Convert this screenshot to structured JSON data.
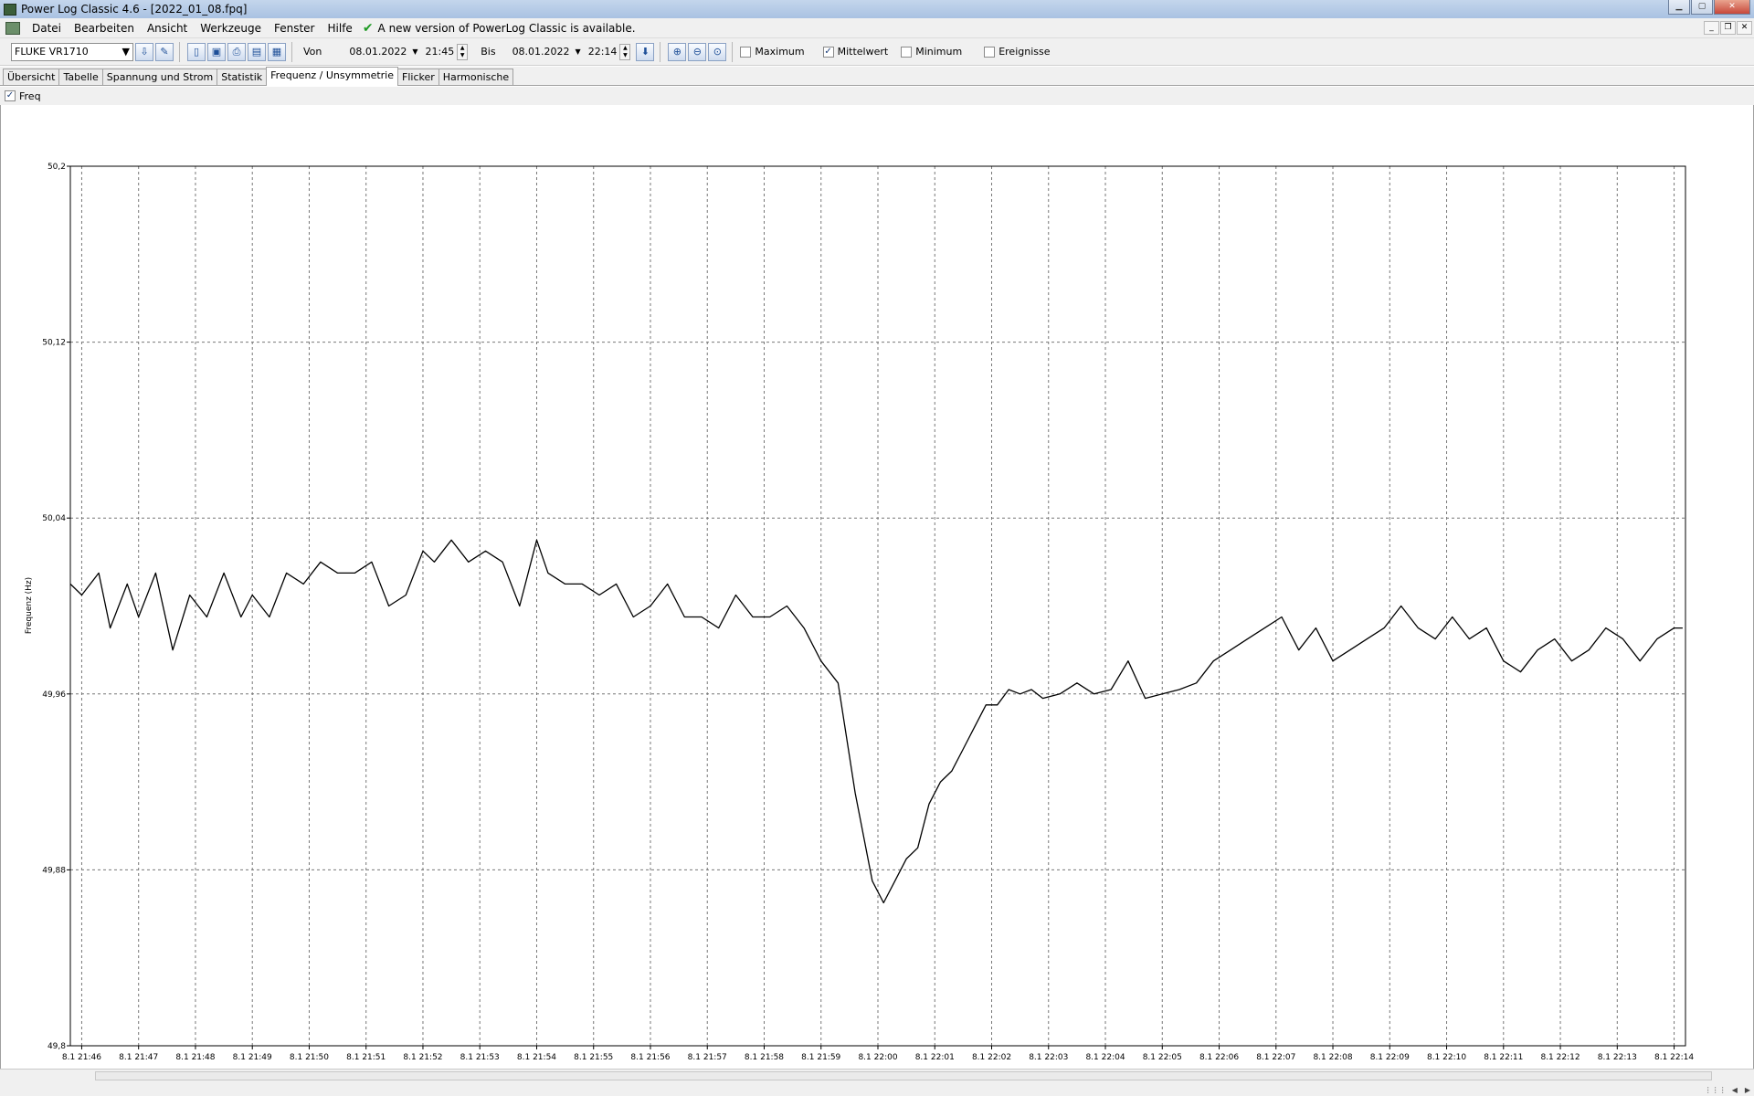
{
  "window": {
    "title": "Power Log Classic 4.6 - [2022_01_08.fpq]"
  },
  "menu": {
    "items": [
      "Datei",
      "Bearbeiten",
      "Ansicht",
      "Werkzeuge",
      "Fenster",
      "Hilfe"
    ],
    "update_notice": "A new version of PowerLog Classic is available."
  },
  "toolbar": {
    "device": "FLUKE VR1710",
    "from_label": "Von",
    "from_date": "08.01.2022",
    "from_time": "21:45",
    "to_label": "Bis",
    "to_date": "08.01.2022",
    "to_time": "22:14",
    "checkboxes": [
      {
        "label": "Maximum",
        "checked": false
      },
      {
        "label": "Mittelwert",
        "checked": true
      },
      {
        "label": "Minimum",
        "checked": false
      },
      {
        "label": "Ereignisse",
        "checked": false
      }
    ]
  },
  "tabs": [
    {
      "label": "Übersicht",
      "active": false
    },
    {
      "label": "Tabelle",
      "active": false
    },
    {
      "label": "Spannung und Strom",
      "active": false
    },
    {
      "label": "Statistik",
      "active": false
    },
    {
      "label": "Frequenz / Unsymmetrie",
      "active": true
    },
    {
      "label": "Flicker",
      "active": false
    },
    {
      "label": "Harmonische",
      "active": false
    }
  ],
  "series_toggle": {
    "label": "Freq",
    "checked": true
  },
  "chart_data": {
    "type": "line",
    "title": "",
    "xlabel": "",
    "ylabel": "Frequenz (Hz)",
    "ylim": [
      49.8,
      50.2
    ],
    "xlim_minutes": [
      45.8,
      74.2
    ],
    "yticks": [
      "50,2",
      "50,12",
      "50,04",
      "49,96",
      "49,88",
      "49,8"
    ],
    "ytick_values": [
      50.2,
      50.12,
      50.04,
      49.96,
      49.88,
      49.8
    ],
    "xtick_labels": [
      "8.1 21:46",
      "8.1 21:47",
      "8.1 21:48",
      "8.1 21:49",
      "8.1 21:50",
      "8.1 21:51",
      "8.1 21:52",
      "8.1 21:53",
      "8.1 21:54",
      "8.1 21:55",
      "8.1 21:56",
      "8.1 21:57",
      "8.1 21:58",
      "8.1 21:59",
      "8.1 22:00",
      "8.1 22:01",
      "8.1 22:02",
      "8.1 22:03",
      "8.1 22:04",
      "8.1 22:05",
      "8.1 22:06",
      "8.1 22:07",
      "8.1 22:08",
      "8.1 22:09",
      "8.1 22:10",
      "8.1 22:11",
      "8.1 22:12",
      "8.1 22:13",
      "8.1 22:14"
    ],
    "grid": true,
    "series": [
      {
        "name": "Freq",
        "color": "#000000",
        "x_minutes_after_21h": [
          45.8,
          46.0,
          46.3,
          46.5,
          46.8,
          47.0,
          47.3,
          47.6,
          47.9,
          48.2,
          48.5,
          48.8,
          49.0,
          49.3,
          49.6,
          49.9,
          50.2,
          50.5,
          50.8,
          51.1,
          51.4,
          51.7,
          52.0,
          52.2,
          52.5,
          52.8,
          53.1,
          53.4,
          53.7,
          54.0,
          54.2,
          54.5,
          54.8,
          55.1,
          55.4,
          55.7,
          56.0,
          56.3,
          56.6,
          56.9,
          57.2,
          57.5,
          57.8,
          58.1,
          58.4,
          58.7,
          59.0,
          59.3,
          59.6,
          59.9,
          60.1,
          60.3,
          60.5,
          60.7,
          60.9,
          61.1,
          61.3,
          61.5,
          61.7,
          61.9,
          62.1,
          62.3,
          62.5,
          62.7,
          62.9,
          63.2,
          63.5,
          63.8,
          64.1,
          64.4,
          64.7,
          65.0,
          65.3,
          65.6,
          65.9,
          66.2,
          66.5,
          66.8,
          67.1,
          67.4,
          67.7,
          68.0,
          68.3,
          68.6,
          68.9,
          69.2,
          69.5,
          69.8,
          70.1,
          70.4,
          70.7,
          71.0,
          71.3,
          71.6,
          71.9,
          72.2,
          72.5,
          72.8,
          73.1,
          73.4,
          73.7,
          74.0,
          74.15
        ],
        "values": [
          50.01,
          50.005,
          50.015,
          49.99,
          50.01,
          49.995,
          50.015,
          49.98,
          50.005,
          49.995,
          50.015,
          49.995,
          50.005,
          49.995,
          50.015,
          50.01,
          50.02,
          50.015,
          50.015,
          50.02,
          50.0,
          50.005,
          50.025,
          50.02,
          50.03,
          50.02,
          50.025,
          50.02,
          50.0,
          50.03,
          50.015,
          50.01,
          50.01,
          50.005,
          50.01,
          49.995,
          50.0,
          50.01,
          49.995,
          49.995,
          49.99,
          50.005,
          49.995,
          49.995,
          50.0,
          49.99,
          49.975,
          49.965,
          49.915,
          49.875,
          49.865,
          49.875,
          49.885,
          49.89,
          49.91,
          49.92,
          49.925,
          49.935,
          49.945,
          49.955,
          49.955,
          49.962,
          49.96,
          49.962,
          49.958,
          49.96,
          49.965,
          49.96,
          49.962,
          49.975,
          49.958,
          49.96,
          49.962,
          49.965,
          49.975,
          49.98,
          49.985,
          49.99,
          49.995,
          49.98,
          49.99,
          49.975,
          49.98,
          49.985,
          49.99,
          50.0,
          49.99,
          49.985,
          49.995,
          49.985,
          49.99,
          49.975,
          49.97,
          49.98,
          49.985,
          49.975,
          49.98,
          49.99,
          49.985,
          49.975,
          49.985,
          49.99,
          49.99
        ]
      }
    ]
  }
}
